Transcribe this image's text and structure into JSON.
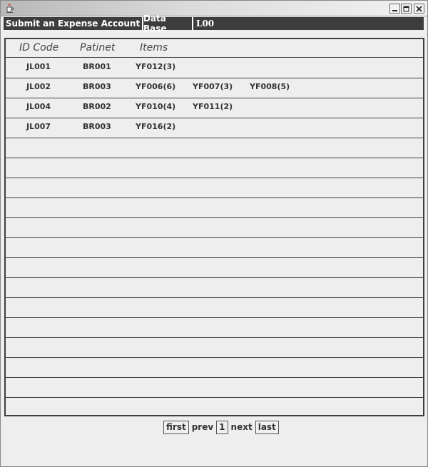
{
  "menubar": {
    "submit_label": "Submit an Expense Account",
    "database_label": "Data Base",
    "user_label": "L00"
  },
  "table": {
    "headers": {
      "id_code": "ID Code",
      "patient": "Patinet",
      "items": "Items"
    },
    "rows": [
      {
        "id": "JL001",
        "patient": "BR001",
        "items": [
          "YF012(3)"
        ]
      },
      {
        "id": "JL002",
        "patient": "BR003",
        "items": [
          "YF006(6)",
          "YF007(3)",
          "YF008(5)"
        ]
      },
      {
        "id": "JL004",
        "patient": "BR002",
        "items": [
          "YF010(4)",
          "YF011(2)"
        ]
      },
      {
        "id": "JL007",
        "patient": "BR003",
        "items": [
          "YF016(2)"
        ]
      }
    ],
    "empty_rows": 14
  },
  "pager": {
    "first": "first",
    "prev": "prev",
    "page": "1",
    "next": "next",
    "last": "last"
  },
  "colors": {
    "menubar_bg": "#3d3d3d",
    "window_bg": "#eeeeee",
    "grid_line": "#404040"
  }
}
